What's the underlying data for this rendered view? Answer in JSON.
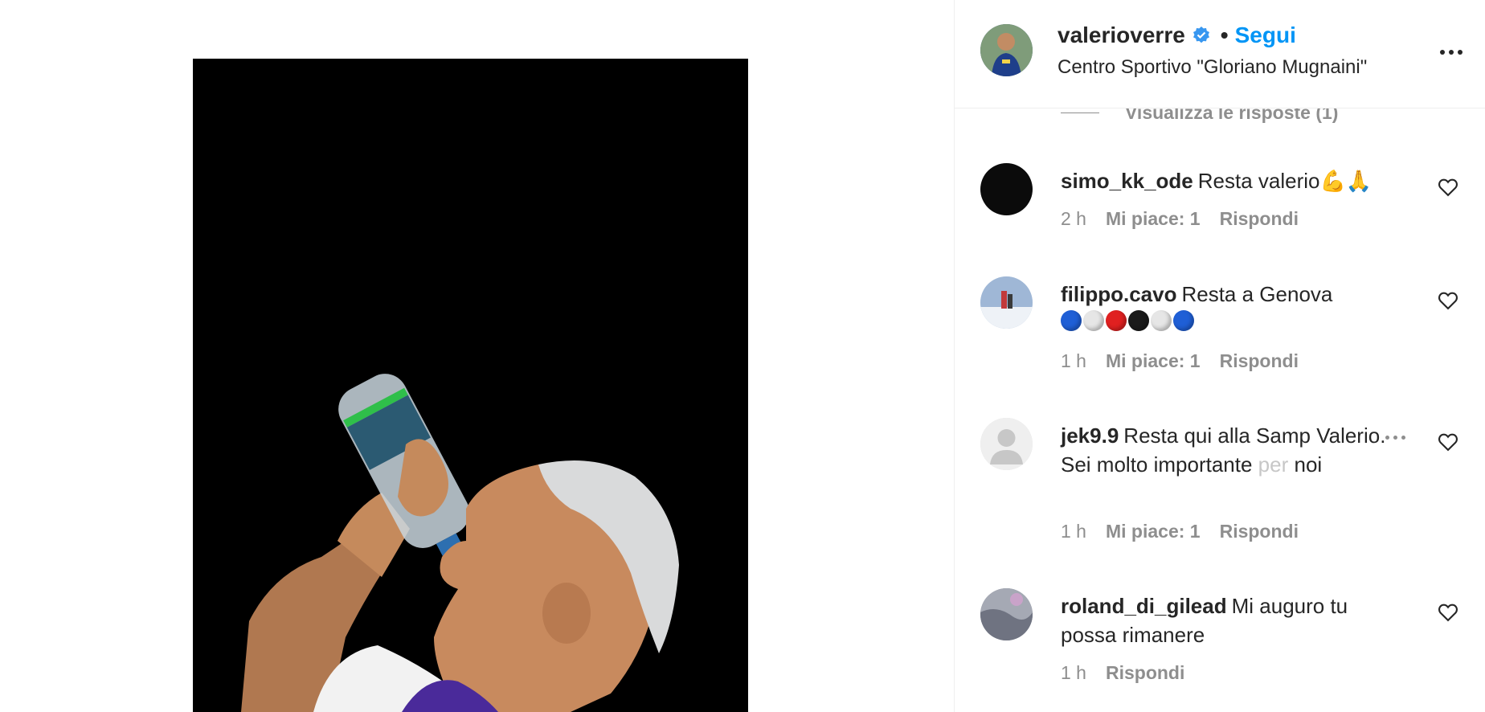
{
  "post": {
    "owner": {
      "username": "valerioverre",
      "verified": true,
      "follow_label": "Segui",
      "separator": "•",
      "location": "Centro Sportivo \"Gloriano Mugnaini\""
    }
  },
  "thread": {
    "view_replies_label": "Visualizza le risposte (1)"
  },
  "comments": [
    {
      "username": "simo_kk_ode",
      "text": "Resta valerio💪🙏",
      "time": "2 h",
      "likes_label": "Mi piace: 1",
      "reply_label": "Rispondi"
    },
    {
      "username": "filippo.cavo",
      "text": "Resta a Genova",
      "emoji_colors": [
        "#1f5fd6",
        "#e6e6e6",
        "#e02020",
        "#1a1a1a",
        "#e6e6e6",
        "#1f5fd6"
      ],
      "time": "1 h",
      "likes_label": "Mi piace: 1",
      "reply_label": "Rispondi"
    },
    {
      "username": "jek9.9",
      "text_start": "Resta qui alla Samp Valerio. Sei molto importante",
      "text_faded": " per",
      "text_end": " noi",
      "time": "1 h",
      "likes_label": "Mi piace: 1",
      "reply_label": "Rispondi"
    },
    {
      "username": "roland_di_gilead",
      "text": "Mi auguro tu possa rimanere",
      "time": "1 h",
      "reply_label": "Rispondi"
    }
  ],
  "icons": {
    "verified": "verified-badge-icon",
    "more": "more-options-icon",
    "like": "heart-outline-icon"
  },
  "colors": {
    "accent": "#0095f6",
    "secondary_text": "#8e8e8e",
    "primary_text": "#262626"
  }
}
